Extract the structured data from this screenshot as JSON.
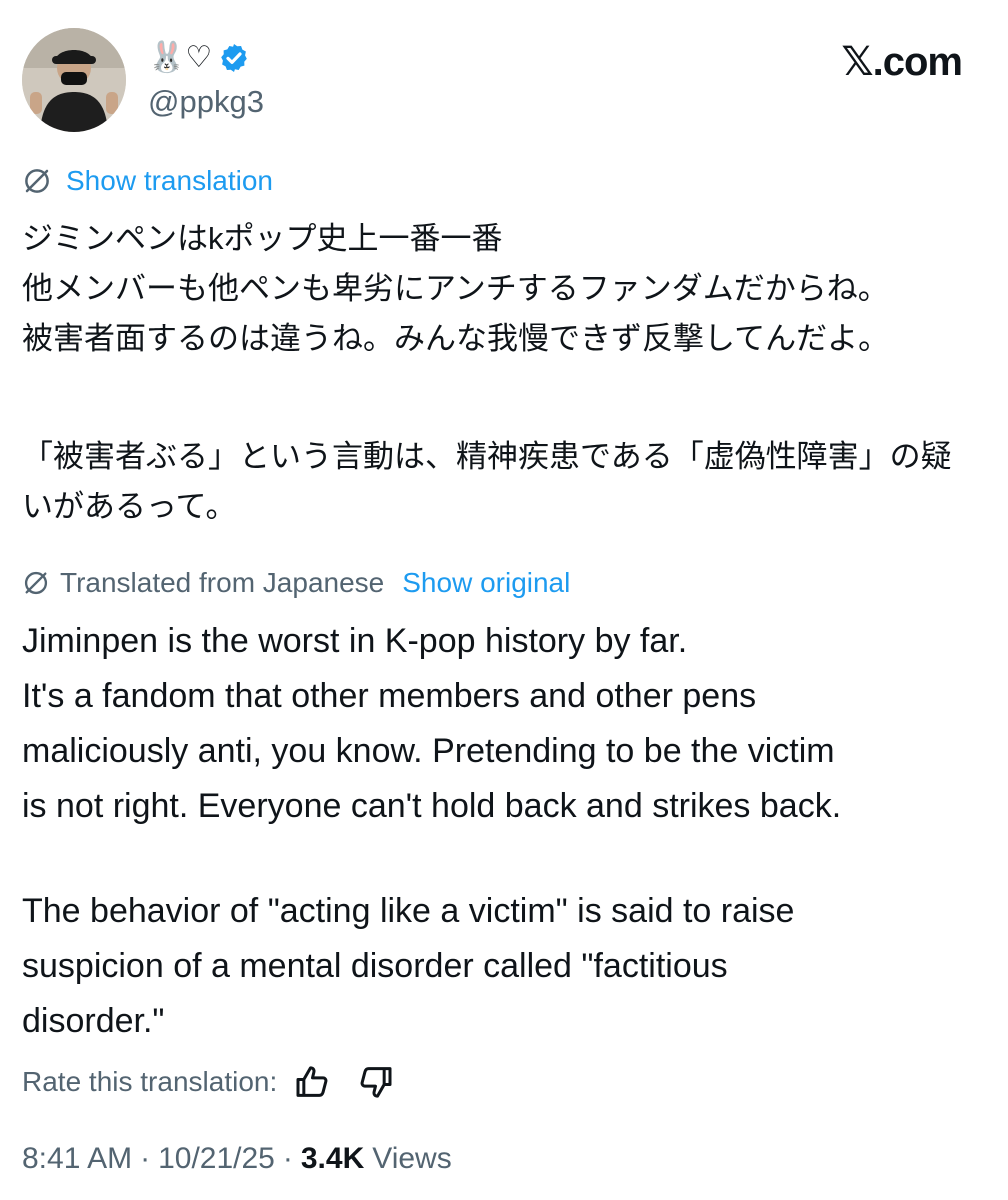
{
  "header": {
    "display_name": "🐰♡",
    "handle": "@ppkg3",
    "brand": "𝕏.com"
  },
  "translation": {
    "show_translation_label": "Show translation",
    "translated_from_label": "Translated from Japanese",
    "show_original_label": "Show original",
    "rate_label": "Rate this translation:"
  },
  "post": {
    "original_paragraph_1": "ジミンペンはkポップ史上一番一番\n他メンバーも他ペンも卑劣にアンチするファンダムだからね。\n被害者面するのは違うね。みんな我慢できず反撃してんだよ。",
    "original_paragraph_2": "「被害者ぶる」という言動は、精神疾患である「虚偽性障害」の疑\nいがあるって。",
    "translated_paragraph_1": "Jiminpen is the worst in K-pop history by far.\nIt's a fandom that other members and other pens\nmaliciously anti, you know. Pretending to be the victim\nis not right. Everyone can't hold back and strikes back.",
    "translated_paragraph_2": "The behavior of \"acting like a victim\" is said to raise\nsuspicion of a mental disorder called \"factitious\ndisorder.\""
  },
  "meta": {
    "time": "8:41 AM",
    "separator": "·",
    "date": "10/21/25",
    "views_count": "3.4K",
    "views_label": "Views"
  },
  "icons": {
    "verified": "verified-badge-icon",
    "translate": "globe-slash-icon",
    "thumbs_up": "thumbs-up-icon",
    "thumbs_down": "thumbs-down-icon"
  },
  "colors": {
    "link": "#1d9bf0",
    "muted": "#536471",
    "text": "#0f1419",
    "background": "#ffffff"
  }
}
